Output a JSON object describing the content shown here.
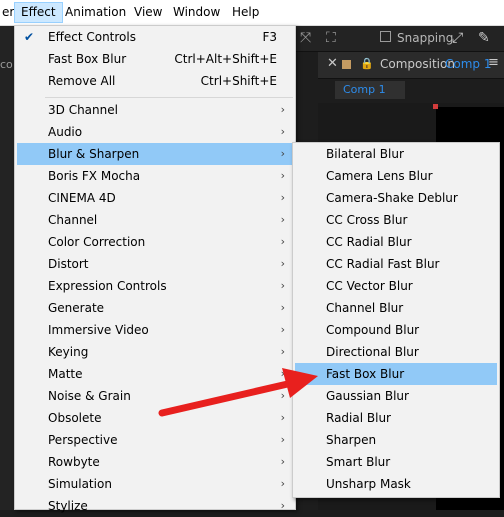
{
  "menubar": {
    "partial_prev": "er",
    "items": [
      "Effect",
      "Animation",
      "View",
      "Window",
      "Help"
    ]
  },
  "toolbar": {
    "snapping_label": "Snapping"
  },
  "composition": {
    "panel_title": "Composition",
    "comp_name": "Comp 1",
    "tab_label": "Comp 1",
    "left_partial": "co"
  },
  "effect_menu": {
    "top_items": [
      {
        "label": "Effect Controls",
        "shortcut": "F3",
        "checked": true
      },
      {
        "label": "Fast Box Blur",
        "shortcut": "Ctrl+Alt+Shift+E",
        "checked": false
      },
      {
        "label": "Remove All",
        "shortcut": "Ctrl+Shift+E",
        "checked": false
      }
    ],
    "categories": [
      "3D Channel",
      "Audio",
      "Blur & Sharpen",
      "Boris FX Mocha",
      "CINEMA 4D",
      "Channel",
      "Color Correction",
      "Distort",
      "Expression Controls",
      "Generate",
      "Immersive Video",
      "Keying",
      "Matte",
      "Noise & Grain",
      "Obsolete",
      "Perspective",
      "Rowbyte",
      "Simulation",
      "Stylize"
    ],
    "highlighted": "Blur & Sharpen"
  },
  "blur_menu": {
    "items": [
      "Bilateral Blur",
      "Camera Lens Blur",
      "Camera-Shake Deblur",
      "CC Cross Blur",
      "CC Radial Blur",
      "CC Radial Fast Blur",
      "CC Vector Blur",
      "Channel Blur",
      "Compound Blur",
      "Directional Blur",
      "Fast Box Blur",
      "Gaussian Blur",
      "Radial Blur",
      "Sharpen",
      "Smart Blur",
      "Unsharp Mask"
    ],
    "highlighted": "Fast Box Blur"
  },
  "colors": {
    "highlight": "#91c9f7",
    "menu_bg": "#f2f2f2",
    "arrow": "#e8201e",
    "comp_accent": "#2d8ceb"
  },
  "icons": {
    "check": "checkmark-icon",
    "submenu": "chevron-right-icon",
    "annotation": "red-arrow-icon"
  }
}
